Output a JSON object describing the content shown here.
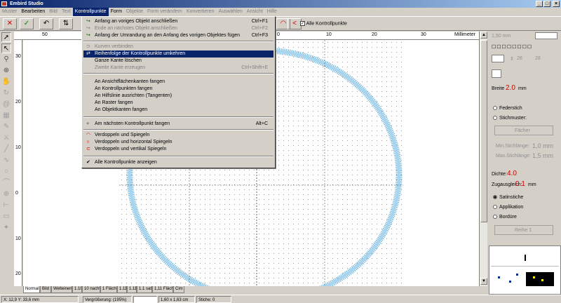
{
  "window": {
    "title": "Embird Studio",
    "controls": [
      "_",
      "□",
      "×"
    ]
  },
  "menubar": [
    {
      "label": "Muster",
      "disabled": true
    },
    {
      "label": "Bearbeiten",
      "disabled": false
    },
    {
      "label": "Bild",
      "disabled": true
    },
    {
      "label": "Text",
      "disabled": true
    },
    {
      "label": "Kontrollpunkte",
      "disabled": false,
      "active": true
    },
    {
      "label": "Form",
      "disabled": false
    },
    {
      "label": "Objekte",
      "disabled": true
    },
    {
      "label": "Form verändern",
      "disabled": true
    },
    {
      "label": "Konvertieren",
      "disabled": true
    },
    {
      "label": "Auswählen",
      "disabled": true
    },
    {
      "label": "Ansicht",
      "disabled": true
    },
    {
      "label": "Hilfe",
      "disabled": true
    }
  ],
  "toolbar": {
    "checkbox_label": "Alle Kontrollpunkte"
  },
  "ruler": {
    "h_marks": [
      "50",
      "40",
      "30",
      "20",
      "10",
      "0",
      "10",
      "20",
      "30"
    ],
    "h_unit": "Millimeter",
    "v_marks": [
      "30",
      "20",
      "10",
      "0",
      "10",
      "20"
    ]
  },
  "dropdown": {
    "items": [
      {
        "label": "Anfang an voriges Objekt anschließen",
        "shortcut": "Ctrl+F1",
        "disabled": false,
        "icon": "join-icon"
      },
      {
        "label": "Ende an nächstes Objekt anschließen",
        "shortcut": "Ctrl+F2",
        "disabled": true,
        "icon": "join-icon"
      },
      {
        "label": "Anfang der Umrandung an den Anfang des vorigen Objektes fügen",
        "shortcut": "Ctrl+F3",
        "disabled": false,
        "icon": "join-icon"
      },
      {
        "label": "Kurven verbinden",
        "shortcut": "",
        "disabled": true,
        "icon": "curve-icon"
      },
      {
        "label": "Reihenfolge der Kontrollpunkte umkehren",
        "shortcut": "",
        "disabled": false,
        "highlighted": true,
        "icon": "reverse-icon"
      },
      {
        "label": "Ganze Kante löschen",
        "shortcut": "",
        "disabled": false
      },
      {
        "label": "Zweite Kante erzeugen",
        "shortcut": "Ctrl+Shift+E",
        "disabled": true
      },
      {
        "label": "An Ansichtflächenkanten fangen",
        "shortcut": "",
        "disabled": false
      },
      {
        "label": "An Kontrollpunkten fangen",
        "shortcut": "",
        "disabled": false
      },
      {
        "label": "An Hilfslinie ausrichten (Tangenten)",
        "shortcut": "",
        "disabled": false
      },
      {
        "label": "An Raster fangen",
        "shortcut": "",
        "disabled": false
      },
      {
        "label": "An Objektkanten fangen",
        "shortcut": "",
        "disabled": false
      },
      {
        "label": "Am nächsten Kontrollpunkt fangen",
        "shortcut": "Alt+C",
        "disabled": false,
        "icon": "snap-icon"
      },
      {
        "label": "Verdoppeln und Spiegeln",
        "shortcut": "",
        "disabled": false,
        "icon": "mirror-icon"
      },
      {
        "label": "Verdoppeln und horizontal Spiegeln",
        "shortcut": "",
        "disabled": false,
        "icon": "mirror-h-icon"
      },
      {
        "label": "Verdoppeln und vertikal Spiegeln",
        "shortcut": "",
        "disabled": false,
        "icon": "mirror-v-icon"
      },
      {
        "label": "Alle Kontrollpunkte anzeigen",
        "shortcut": "",
        "disabled": false,
        "checked": true,
        "icon": "check-icon"
      }
    ]
  },
  "right_panel": {
    "size_label": "1,50 mm",
    "pen_w": "28",
    "pen_h": "28",
    "breite_label": "Breite",
    "breite_value": "2.0",
    "breite_unit": "mm",
    "option_federstich": "Federstich",
    "option_stichmuster": "Stichmuster:",
    "pattern_label": "Fächer",
    "min_stichlaenge": "Min.Stichlänge:",
    "min_value": "1,0 mm",
    "max_stichlaenge": "Max.Stichlänge:",
    "max_value": "1,5 mm",
    "dichte_label": "Dichte:",
    "dichte_value": "4.0",
    "zugausgleich_label": "Zugausgleich:",
    "zugausgleich_value": "0.1",
    "zugausgleich_unit": "mm",
    "option_satinstiche": "Satinstiche",
    "option_applikation": "Applikation",
    "option_bordure": "Bordüre",
    "row_label": "Reihe 1"
  },
  "tabs": [
    "Normal",
    "Bild",
    "Welteinen",
    "1.10",
    "10 nacht",
    "1 Fläche",
    "1.11",
    "1.11",
    "1.1 satt",
    "1,11 Fläche",
    "Cim"
  ],
  "status": {
    "coords": "X: 12,9  Y: 33,6 mm",
    "zoom": "Vergrößerung: (195%)",
    "size": "1,60 x 1,63 cm",
    "stiche": "Stiche: 0"
  }
}
